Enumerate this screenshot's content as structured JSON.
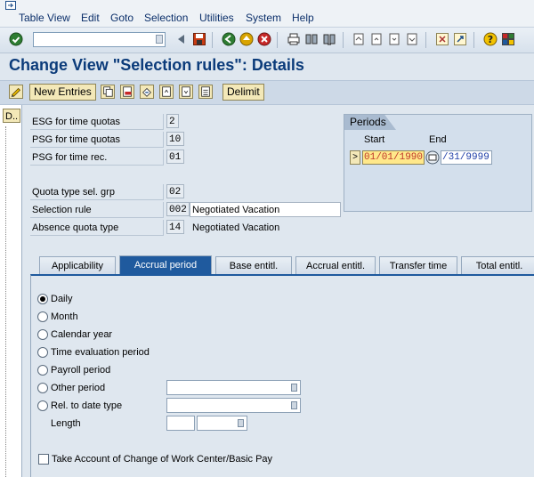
{
  "menu": {
    "items": [
      "Table View",
      "Edit",
      "Goto",
      "Selection",
      "Utilities",
      "System",
      "Help"
    ]
  },
  "title": "Change View \"Selection rules\": Details",
  "app_toolbar": {
    "new_entries": "New Entries",
    "delimit": "Delimit"
  },
  "side_panel": {
    "label": "D.."
  },
  "fields": {
    "esg_time_quotas": {
      "label": "ESG for time quotas",
      "value": "2"
    },
    "psg_time_quotas": {
      "label": "PSG for time quotas",
      "value": "10"
    },
    "psg_time_rec": {
      "label": "PSG for time rec.",
      "value": "01"
    },
    "quota_type_sel_grp": {
      "label": "Quota type sel. grp",
      "value": "02"
    },
    "selection_rule": {
      "label": "Selection rule",
      "value": "002",
      "text": "Negotiated Vacation"
    },
    "absence_quota_type": {
      "label": "Absence quota type",
      "value": "14",
      "text": "Negotiated Vacation"
    }
  },
  "periods": {
    "title": "Periods",
    "start_label": "Start",
    "end_label": "End",
    "start_value": "01/01/1990",
    "end_value": "/31/9999",
    "selector": ">"
  },
  "tabs": [
    {
      "label": "Applicability",
      "active": false
    },
    {
      "label": "Accrual period",
      "active": true
    },
    {
      "label": "Base entitl.",
      "active": false
    },
    {
      "label": "Accrual entitl.",
      "active": false
    },
    {
      "label": "Transfer time",
      "active": false
    },
    {
      "label": "Total entitl.",
      "active": false
    }
  ],
  "accrual_period": {
    "options": [
      "Daily",
      "Month",
      "Calendar year",
      "Time evaluation period",
      "Payroll period",
      "Other period",
      "Rel. to date type"
    ],
    "selected": "Daily",
    "length_label": "Length",
    "checkbox_label": "Take Account of Change of Work Center/Basic Pay",
    "checkbox_checked": false
  },
  "colors": {
    "accent": "#1f5a9e",
    "title": "#0b3b7a",
    "button": "#f3e8b8",
    "period_highlight": "#ffe88a"
  }
}
